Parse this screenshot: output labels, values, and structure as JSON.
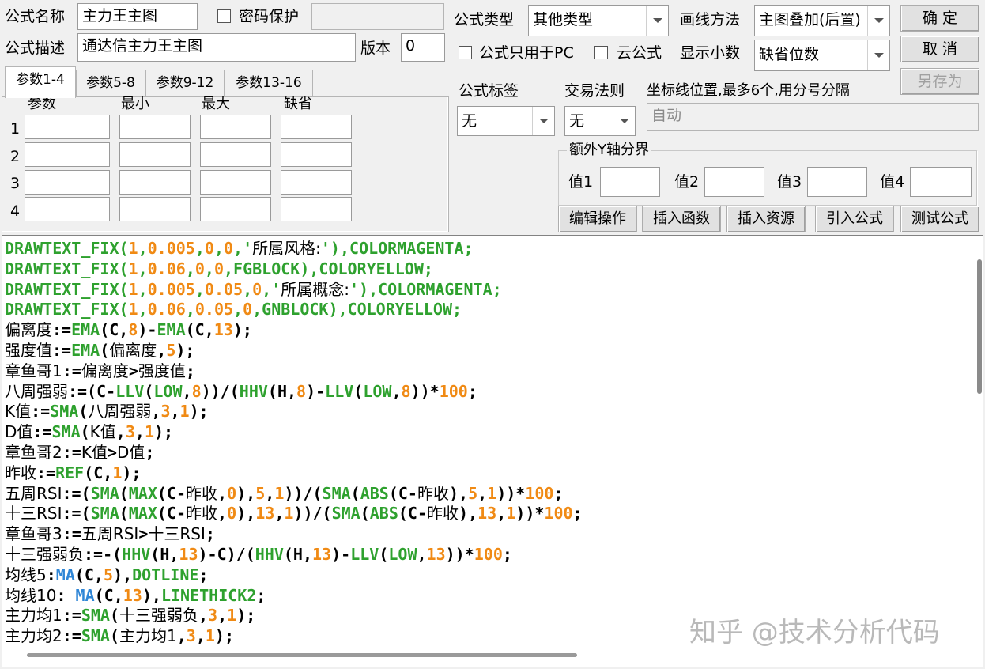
{
  "formula": {
    "name_label": "公式名称",
    "name_value": "主力王主图",
    "password_label": "密码保护",
    "password_value": "",
    "desc_label": "公式描述",
    "desc_value": "通达信主力王主图",
    "version_label": "版本",
    "version_value": "0",
    "type_label": "公式类型",
    "type_value": "其他类型",
    "draw_label": "画线方法",
    "draw_value": "主图叠加(后置)",
    "pc_only_label": "公式只用于PC",
    "cloud_label": "云公式",
    "decimal_label": "显示小数",
    "decimal_value": "缺省位数",
    "tag_label": "公式标签",
    "tag_value": "无",
    "trade_label": "交易法则",
    "trade_value": "无",
    "axis_label": "坐标线位置,最多6个,用分号分隔",
    "axis_value": "自动"
  },
  "buttons": {
    "ok": "确  定",
    "cancel": "取  消",
    "save_as": "另存为",
    "edit": "编辑操作",
    "insert_func": "插入函数",
    "insert_res": "插入资源",
    "import": "引入公式",
    "test": "测试公式"
  },
  "tabs": [
    "参数1-4",
    "参数5-8",
    "参数9-12",
    "参数13-16"
  ],
  "params": {
    "headers": [
      "参数",
      "最小",
      "最大",
      "缺省"
    ],
    "rows": [
      "1",
      "2",
      "3",
      "4"
    ]
  },
  "yaxis": {
    "legend": "额外Y轴分界",
    "labels": [
      "值1",
      "值2",
      "值3",
      "值4"
    ]
  },
  "code_lines": [
    [
      [
        "DRAWTEXT_FIX(",
        "g"
      ],
      [
        "1",
        "o"
      ],
      [
        ",",
        "g"
      ],
      [
        "0.005",
        "o"
      ],
      [
        ",",
        "g"
      ],
      [
        "0",
        "o"
      ],
      [
        ",",
        "g"
      ],
      [
        "0",
        "o"
      ],
      [
        ",'",
        "g"
      ],
      [
        "所属风格:",
        "kt"
      ],
      [
        "'),COLORMAGENTA;",
        "g"
      ]
    ],
    [
      [
        "DRAWTEXT_FIX(",
        "g"
      ],
      [
        "1",
        "o"
      ],
      [
        ",",
        "g"
      ],
      [
        "0.06",
        "o"
      ],
      [
        ",",
        "g"
      ],
      [
        "0",
        "o"
      ],
      [
        ",",
        "g"
      ],
      [
        "0",
        "o"
      ],
      [
        ",FGBLOCK),COLORYELLOW;",
        "g"
      ]
    ],
    [
      [
        "DRAWTEXT_FIX(",
        "g"
      ],
      [
        "1",
        "o"
      ],
      [
        ",",
        "g"
      ],
      [
        "0.005",
        "o"
      ],
      [
        ",",
        "g"
      ],
      [
        "0.05",
        "o"
      ],
      [
        ",",
        "g"
      ],
      [
        "0",
        "o"
      ],
      [
        ",'",
        "g"
      ],
      [
        "所属概念:",
        "kt"
      ],
      [
        "'),COLORMAGENTA;",
        "g"
      ]
    ],
    [
      [
        "DRAWTEXT_FIX(",
        "g"
      ],
      [
        "1",
        "o"
      ],
      [
        ",",
        "g"
      ],
      [
        "0.06",
        "o"
      ],
      [
        ",",
        "g"
      ],
      [
        "0.05",
        "o"
      ],
      [
        ",",
        "g"
      ],
      [
        "0",
        "o"
      ],
      [
        ",GNBLOCK),COLORYELLOW;",
        "g"
      ]
    ],
    [
      [
        "偏离度",
        "kt"
      ],
      [
        ":=",
        "k"
      ],
      [
        "EMA",
        "g"
      ],
      [
        "(C,",
        "k"
      ],
      [
        "8",
        "o"
      ],
      [
        ")-",
        "k"
      ],
      [
        "EMA",
        "g"
      ],
      [
        "(C,",
        "k"
      ],
      [
        "13",
        "o"
      ],
      [
        ");",
        "k"
      ]
    ],
    [
      [
        "强度值",
        "kt"
      ],
      [
        ":=",
        "k"
      ],
      [
        "EMA",
        "g"
      ],
      [
        "(",
        "k"
      ],
      [
        "偏离度",
        "kt"
      ],
      [
        ",",
        "k"
      ],
      [
        "5",
        "o"
      ],
      [
        ");",
        "k"
      ]
    ],
    [
      [
        "章鱼哥1",
        "kt"
      ],
      [
        ":=",
        "k"
      ],
      [
        "偏离度",
        "kt"
      ],
      [
        ">",
        "k"
      ],
      [
        "强度值",
        "kt"
      ],
      [
        ";",
        "k"
      ]
    ],
    [
      [
        "八周强弱",
        "kt"
      ],
      [
        ":=(C-",
        "k"
      ],
      [
        "LLV",
        "g"
      ],
      [
        "(",
        "k"
      ],
      [
        "LOW",
        "g"
      ],
      [
        ",",
        "k"
      ],
      [
        "8",
        "o"
      ],
      [
        "))/(",
        "k"
      ],
      [
        "HHV",
        "g"
      ],
      [
        "(H,",
        "k"
      ],
      [
        "8",
        "o"
      ],
      [
        ")-",
        "k"
      ],
      [
        "LLV",
        "g"
      ],
      [
        "(",
        "k"
      ],
      [
        "LOW",
        "g"
      ],
      [
        ",",
        "k"
      ],
      [
        "8",
        "o"
      ],
      [
        "))*",
        "k"
      ],
      [
        "100",
        "o"
      ],
      [
        ";",
        "k"
      ]
    ],
    [
      [
        "K值",
        "kt"
      ],
      [
        ":=",
        "k"
      ],
      [
        "SMA",
        "g"
      ],
      [
        "(",
        "k"
      ],
      [
        "八周强弱",
        "kt"
      ],
      [
        ",",
        "k"
      ],
      [
        "3",
        "o"
      ],
      [
        ",",
        "k"
      ],
      [
        "1",
        "o"
      ],
      [
        ");",
        "k"
      ]
    ],
    [
      [
        "D值",
        "kt"
      ],
      [
        ":=",
        "k"
      ],
      [
        "SMA",
        "g"
      ],
      [
        "(",
        "k"
      ],
      [
        "K值",
        "kt"
      ],
      [
        ",",
        "k"
      ],
      [
        "3",
        "o"
      ],
      [
        ",",
        "k"
      ],
      [
        "1",
        "o"
      ],
      [
        ");",
        "k"
      ]
    ],
    [
      [
        "章鱼哥2",
        "kt"
      ],
      [
        ":=",
        "k"
      ],
      [
        "K值",
        "kt"
      ],
      [
        ">",
        "k"
      ],
      [
        "D值",
        "kt"
      ],
      [
        ";",
        "k"
      ]
    ],
    [
      [
        "昨收",
        "kt"
      ],
      [
        ":=",
        "k"
      ],
      [
        "REF",
        "g"
      ],
      [
        "(C,",
        "k"
      ],
      [
        "1",
        "o"
      ],
      [
        ");",
        "k"
      ]
    ],
    [
      [
        "五周RSI",
        "kt"
      ],
      [
        ":=(",
        "k"
      ],
      [
        "SMA",
        "g"
      ],
      [
        "(",
        "k"
      ],
      [
        "MAX",
        "g"
      ],
      [
        "(C-",
        "k"
      ],
      [
        "昨收",
        "kt"
      ],
      [
        ",",
        "k"
      ],
      [
        "0",
        "o"
      ],
      [
        "),",
        "k"
      ],
      [
        "5",
        "o"
      ],
      [
        ",",
        "k"
      ],
      [
        "1",
        "o"
      ],
      [
        "))/(",
        "k"
      ],
      [
        "SMA",
        "g"
      ],
      [
        "(",
        "k"
      ],
      [
        "ABS",
        "g"
      ],
      [
        "(C-",
        "k"
      ],
      [
        "昨收",
        "kt"
      ],
      [
        "),",
        "k"
      ],
      [
        "5",
        "o"
      ],
      [
        ",",
        "k"
      ],
      [
        "1",
        "o"
      ],
      [
        "))*",
        "k"
      ],
      [
        "100",
        "o"
      ],
      [
        ";",
        "k"
      ]
    ],
    [
      [
        "十三RSI",
        "kt"
      ],
      [
        ":=(",
        "k"
      ],
      [
        "SMA",
        "g"
      ],
      [
        "(",
        "k"
      ],
      [
        "MAX",
        "g"
      ],
      [
        "(C-",
        "k"
      ],
      [
        "昨收",
        "kt"
      ],
      [
        ",",
        "k"
      ],
      [
        "0",
        "o"
      ],
      [
        "),",
        "k"
      ],
      [
        "13",
        "o"
      ],
      [
        ",",
        "k"
      ],
      [
        "1",
        "o"
      ],
      [
        "))/(",
        "k"
      ],
      [
        "SMA",
        "g"
      ],
      [
        "(",
        "k"
      ],
      [
        "ABS",
        "g"
      ],
      [
        "(C-",
        "k"
      ],
      [
        "昨收",
        "kt"
      ],
      [
        "),",
        "k"
      ],
      [
        "13",
        "o"
      ],
      [
        ",",
        "k"
      ],
      [
        "1",
        "o"
      ],
      [
        "))*",
        "k"
      ],
      [
        "100",
        "o"
      ],
      [
        ";",
        "k"
      ]
    ],
    [
      [
        "章鱼哥3",
        "kt"
      ],
      [
        ":=",
        "k"
      ],
      [
        "五周RSI",
        "kt"
      ],
      [
        ">",
        "k"
      ],
      [
        "十三RSI",
        "kt"
      ],
      [
        ";",
        "k"
      ]
    ],
    [
      [
        "十三强弱负",
        "kt"
      ],
      [
        ":=-(",
        "k"
      ],
      [
        "HHV",
        "g"
      ],
      [
        "(H,",
        "k"
      ],
      [
        "13",
        "o"
      ],
      [
        ")-C)/(",
        "k"
      ],
      [
        "HHV",
        "g"
      ],
      [
        "(H,",
        "k"
      ],
      [
        "13",
        "o"
      ],
      [
        ")-",
        "k"
      ],
      [
        "LLV",
        "g"
      ],
      [
        "(",
        "k"
      ],
      [
        "LOW",
        "g"
      ],
      [
        ",",
        "k"
      ],
      [
        "13",
        "o"
      ],
      [
        "))*",
        "k"
      ],
      [
        "100",
        "o"
      ],
      [
        ";",
        "k"
      ]
    ],
    [
      [
        "均线5",
        "kt"
      ],
      [
        ":",
        "k"
      ],
      [
        "MA",
        "b"
      ],
      [
        "(C,",
        "k"
      ],
      [
        "5",
        "o"
      ],
      [
        "),",
        "k"
      ],
      [
        "DOTLINE",
        "g"
      ],
      [
        ";",
        "k"
      ]
    ],
    [
      [
        "均线10",
        "kt"
      ],
      [
        ": ",
        "k"
      ],
      [
        "MA",
        "b"
      ],
      [
        "(C,",
        "k"
      ],
      [
        "13",
        "o"
      ],
      [
        "),",
        "k"
      ],
      [
        "LINETHICK2",
        "g"
      ],
      [
        ";",
        "k"
      ]
    ],
    [
      [
        "主力均1",
        "kt"
      ],
      [
        ":=",
        "k"
      ],
      [
        "SMA",
        "g"
      ],
      [
        "(",
        "k"
      ],
      [
        "十三强弱负",
        "kt"
      ],
      [
        ",",
        "k"
      ],
      [
        "3",
        "o"
      ],
      [
        ",",
        "k"
      ],
      [
        "1",
        "o"
      ],
      [
        ");",
        "k"
      ]
    ],
    [
      [
        "主力均2",
        "kt"
      ],
      [
        ":=",
        "k"
      ],
      [
        "SMA",
        "g"
      ],
      [
        "(",
        "k"
      ],
      [
        "主力均1",
        "kt"
      ],
      [
        ",",
        "k"
      ],
      [
        "3",
        "o"
      ],
      [
        ",",
        "k"
      ],
      [
        "1",
        "o"
      ],
      [
        ");",
        "k"
      ]
    ]
  ],
  "watermark": "知乎 @技术分析代码",
  "colors": {
    "function": "#2ea12e",
    "number": "#f08a14",
    "ma": "#2f86d6",
    "background": "#f0f0f0"
  }
}
